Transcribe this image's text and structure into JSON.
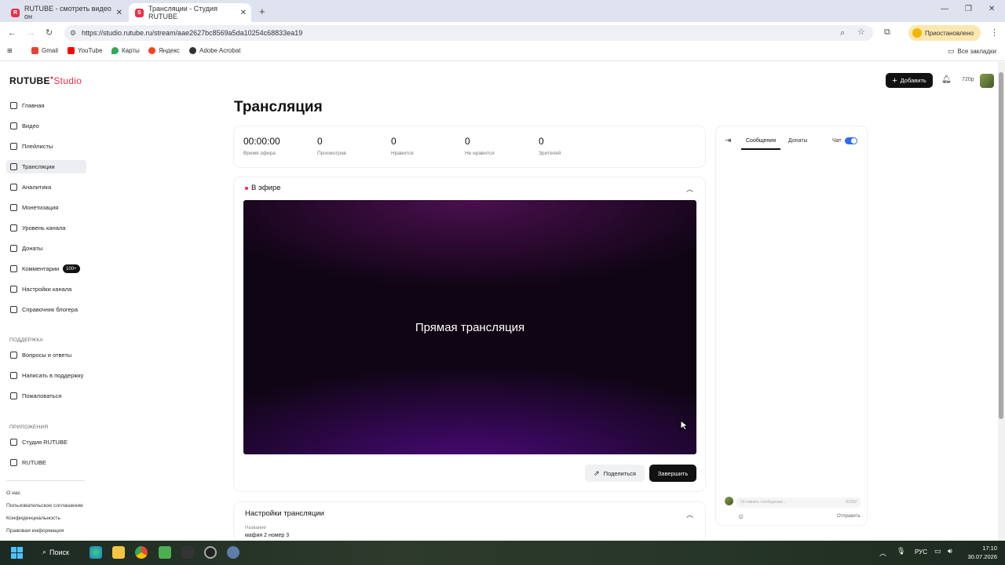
{
  "browser": {
    "tabs": [
      {
        "title": "RUTUBE - смотреть видео он"
      },
      {
        "title": "Трансляции - Студия RUTUBE"
      }
    ],
    "url": "https://studio.rutube.ru/stream/aae2627bc8569a5da10254c68833ea19",
    "profile_label": "Приостановлено",
    "bookmarks": [
      {
        "label": "Gmail",
        "color": "#ea4335"
      },
      {
        "label": "YouTube",
        "color": "#ff0000"
      },
      {
        "label": "Карты",
        "color": "#34a853"
      },
      {
        "label": "Яндекс",
        "color": "#fc3f1d"
      },
      {
        "label": "Adobe Acrobat",
        "color": "#333333"
      }
    ],
    "all_bookmarks": "Все закладки"
  },
  "header": {
    "logo_main": "RUTUBE",
    "logo_sub": "Studio",
    "add_button": "Добавить",
    "quality": "720p"
  },
  "sidebar": {
    "items": [
      {
        "label": "Главная",
        "icon": "home-icon"
      },
      {
        "label": "Видео",
        "icon": "video-icon"
      },
      {
        "label": "Плейлисты",
        "icon": "playlist-icon"
      },
      {
        "label": "Трансляции",
        "icon": "broadcast-icon"
      },
      {
        "label": "Аналитика",
        "icon": "analytics-icon"
      },
      {
        "label": "Монетизация",
        "icon": "money-icon"
      },
      {
        "label": "Уровень канала",
        "icon": "star-icon"
      },
      {
        "label": "Донаты",
        "icon": "donate-icon"
      },
      {
        "label": "Комментарии",
        "icon": "comment-icon"
      },
      {
        "label": "Настройки канала",
        "icon": "gear-icon"
      },
      {
        "label": "Справочник блогера",
        "icon": "info-icon"
      }
    ],
    "comments_badge": "100+",
    "support_heading": "ПОДДЕРЖКА",
    "support_items": [
      {
        "label": "Вопросы и ответы",
        "icon": "question-icon"
      },
      {
        "label": "Написать в поддержку",
        "icon": "mail-icon"
      },
      {
        "label": "Пожаловаться",
        "icon": "flag-icon"
      }
    ],
    "apps_heading": "ПРИЛОЖЕНИЯ",
    "app_items": [
      {
        "label": "Студия RUTUBE",
        "icon": "rutube-studio-icon"
      },
      {
        "label": "RUTUBE",
        "icon": "rutube-icon"
      }
    ],
    "footer_links": [
      "О нас",
      "Пользовательское соглашение",
      "Конфиденциальность",
      "Правовая информация"
    ]
  },
  "main": {
    "page_title": "Трансляция",
    "stats": [
      {
        "value": "00:00:00",
        "label": "Время эфира"
      },
      {
        "value": "0",
        "label": "Просмотров"
      },
      {
        "value": "0",
        "label": "Нравится"
      },
      {
        "value": "0",
        "label": "Не нравится"
      },
      {
        "value": "0",
        "label": "Зрителей"
      }
    ],
    "live_status": "В эфире",
    "live_color": "#e8304a",
    "player_text": "Прямая трансляция",
    "share_button": "Поделиться",
    "finish_button": "Завершить",
    "settings_title": "Настройки трансляции",
    "name_label": "Название",
    "name_value": "мафия 2 номер 3"
  },
  "chat": {
    "tabs": [
      "Сообщения",
      "Донаты"
    ],
    "chat_toggle_label": "Чат",
    "toggle_on": true,
    "input_placeholder": "Оставить сообщение...",
    "counter": "0/200",
    "send_button": "Отправить",
    "accent": "#2f6cf2"
  },
  "taskbar": {
    "search_label": "Поиск",
    "lang": "РУС",
    "time": "17:10",
    "date": "30.07.2026"
  }
}
